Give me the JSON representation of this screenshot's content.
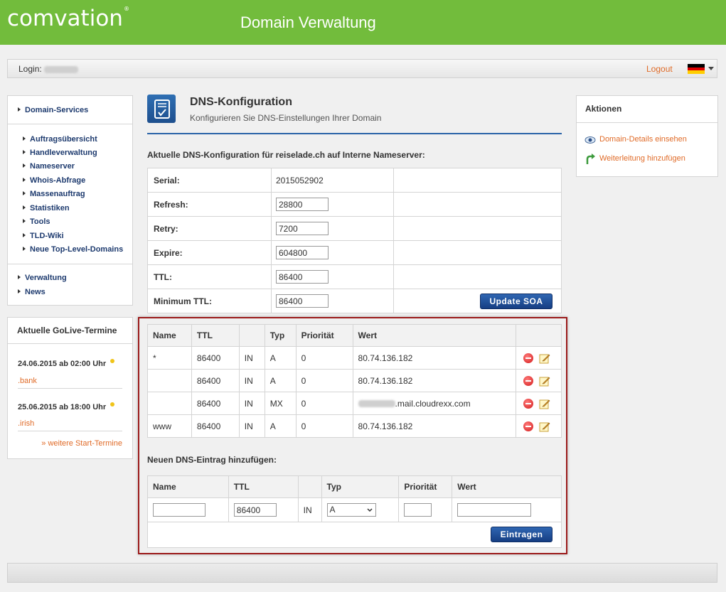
{
  "header": {
    "logo": "comvation",
    "logo_mark": "®",
    "title": "Domain Verwaltung"
  },
  "loginbar": {
    "login_label": "Login:",
    "logout": "Logout",
    "language": "de"
  },
  "nav": {
    "sections": [
      {
        "label": "Domain-Services"
      },
      {
        "label": "Verwaltung"
      },
      {
        "label": "News"
      }
    ],
    "subitems": [
      "Auftragsübersicht",
      "Handleverwaltung",
      "Nameserver",
      "Whois-Abfrage",
      "Massenauftrag",
      "Statistiken",
      "Tools",
      "TLD-Wiki",
      "Neue Top-Level-Domains"
    ]
  },
  "golive": {
    "title": "Aktuelle GoLive-Termine",
    "entries": [
      {
        "date": "24.06.2015 ab 02:00 Uhr",
        "tld": ".bank"
      },
      {
        "date": "25.06.2015 ab 18:00 Uhr",
        "tld": ".irish"
      }
    ],
    "more": "» weitere Start-Termine"
  },
  "page": {
    "title": "DNS-Konfiguration",
    "subtitle": "Konfigurieren Sie DNS-Einstellungen Ihrer Domain",
    "section_current": "Aktuelle DNS-Konfiguration für reiselade.ch auf Interne Nameserver:",
    "section_new": "Neuen DNS-Eintrag hinzufügen:"
  },
  "soa": {
    "serial_label": "Serial:",
    "serial_value": "2015052902",
    "refresh_label": "Refresh:",
    "refresh_value": "28800",
    "retry_label": "Retry:",
    "retry_value": "7200",
    "expire_label": "Expire:",
    "expire_value": "604800",
    "ttl_label": "TTL:",
    "ttl_value": "86400",
    "minttl_label": "Minimum TTL:",
    "minttl_value": "86400",
    "update_button": "Update SOA"
  },
  "records": {
    "headers": {
      "name": "Name",
      "ttl": "TTL",
      "class": "",
      "type": "Typ",
      "priority": "Priorität",
      "value": "Wert"
    },
    "rows": [
      {
        "name": "*",
        "ttl": "86400",
        "class": "IN",
        "type": "A",
        "priority": "0",
        "value": "80.74.136.182"
      },
      {
        "name": "",
        "ttl": "86400",
        "class": "IN",
        "type": "A",
        "priority": "0",
        "value": "80.74.136.182"
      },
      {
        "name": "",
        "ttl": "86400",
        "class": "IN",
        "type": "MX",
        "priority": "0",
        "value": ".mail.cloudrexx.com"
      },
      {
        "name": "www",
        "ttl": "86400",
        "class": "IN",
        "type": "A",
        "priority": "0",
        "value": "80.74.136.182"
      }
    ]
  },
  "newentry": {
    "headers": {
      "name": "Name",
      "ttl": "TTL",
      "type": "Typ",
      "priority": "Priorität",
      "value": "Wert"
    },
    "name_value": "",
    "ttl_value": "86400",
    "class": "IN",
    "type_selected": "A",
    "priority_value": "",
    "value_value": "",
    "submit": "Eintragen"
  },
  "actions": {
    "title": "Aktionen",
    "links": [
      {
        "label": "Domain-Details einsehen",
        "icon": "eye-icon"
      },
      {
        "label": "Weiterleitung hinzufügen",
        "icon": "forward-arrow-icon"
      }
    ]
  },
  "colors": {
    "brand_green": "#72bc3c",
    "link_orange": "#e06b28",
    "button_blue": "#1f4f94",
    "highlight_red": "#9b1a1a"
  }
}
